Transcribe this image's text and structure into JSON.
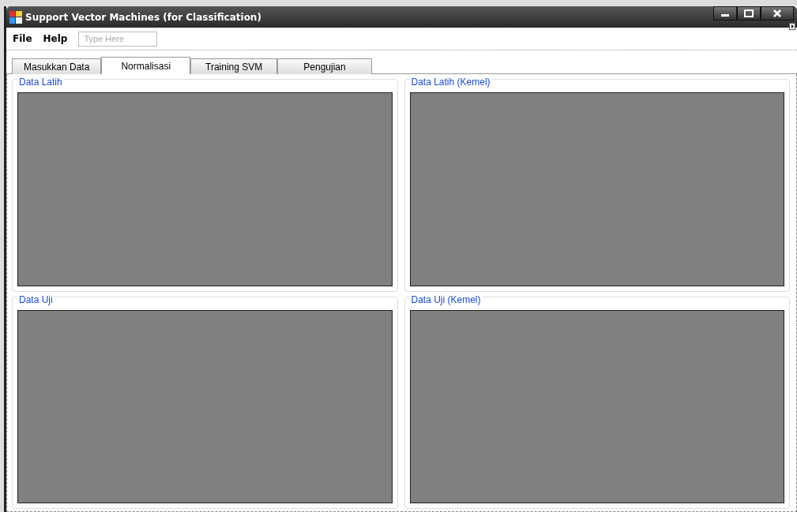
{
  "window": {
    "title": "Support Vector Machines (for Classification)"
  },
  "menu": {
    "items": [
      "File",
      "Help"
    ],
    "placeholder": "Type Here"
  },
  "tabs": [
    {
      "label": "Masukkan Data",
      "selected": false
    },
    {
      "label": "Normalisasi",
      "selected": true
    },
    {
      "label": "Training SVM",
      "selected": false
    },
    {
      "label": "Pengujian",
      "selected": false
    }
  ],
  "groups": [
    {
      "title": "Data Latih"
    },
    {
      "title": "Data Latih (Kemel)"
    },
    {
      "title": "Data Uji"
    },
    {
      "title": "Data Uji (Kemel)"
    }
  ]
}
